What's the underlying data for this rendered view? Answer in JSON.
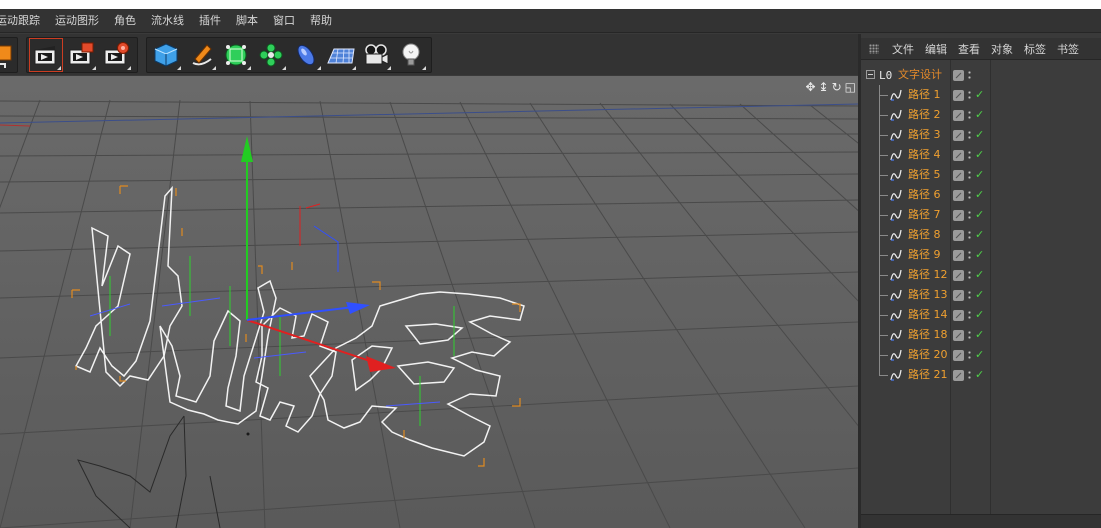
{
  "menubar": {
    "items": [
      "运动跟踪",
      "运动图形",
      "角色",
      "流水线",
      "插件",
      "脚本",
      "窗口",
      "帮助"
    ]
  },
  "toolbar": {
    "groups": [
      {
        "buttons": [
          "cube-edit-icon"
        ]
      },
      {
        "buttons": [
          "render-view-icon",
          "render-picture-viewer-icon",
          "render-settings-icon"
        ]
      },
      {
        "buttons": [
          "cube-primitive-icon",
          "pen-spline-icon",
          "subdivision-generator-icon",
          "cloner-icon",
          "deformer-icon",
          "floor-plane-icon",
          "camera-icon",
          "light-icon"
        ]
      }
    ]
  },
  "viewport": {
    "tool_icons": [
      "move-view-icon",
      "pan-view-icon",
      "rotate-view-icon",
      "maximize-view-icon"
    ]
  },
  "object_manager": {
    "menu": [
      "文件",
      "编辑",
      "查看",
      "对象",
      "标签",
      "书签"
    ],
    "root": {
      "name": "文字设计",
      "icon": "null-object-icon"
    },
    "children": [
      {
        "name": "路径 1"
      },
      {
        "name": "路径 2"
      },
      {
        "name": "路径 3"
      },
      {
        "name": "路径 4"
      },
      {
        "name": "路径 5"
      },
      {
        "name": "路径 6"
      },
      {
        "name": "路径 7"
      },
      {
        "name": "路径 8"
      },
      {
        "name": "路径 9"
      },
      {
        "name": "路径 12"
      },
      {
        "name": "路径 13"
      },
      {
        "name": "路径 14"
      },
      {
        "name": "路径 18"
      },
      {
        "name": "路径 20"
      },
      {
        "name": "路径 21"
      }
    ]
  },
  "colors": {
    "accent_orange": "#f0a030",
    "check_green": "#4fd14a",
    "active_red": "#cc3d22",
    "axis_x": "#e02020",
    "axis_y": "#22cc22",
    "axis_z": "#3050ff"
  }
}
